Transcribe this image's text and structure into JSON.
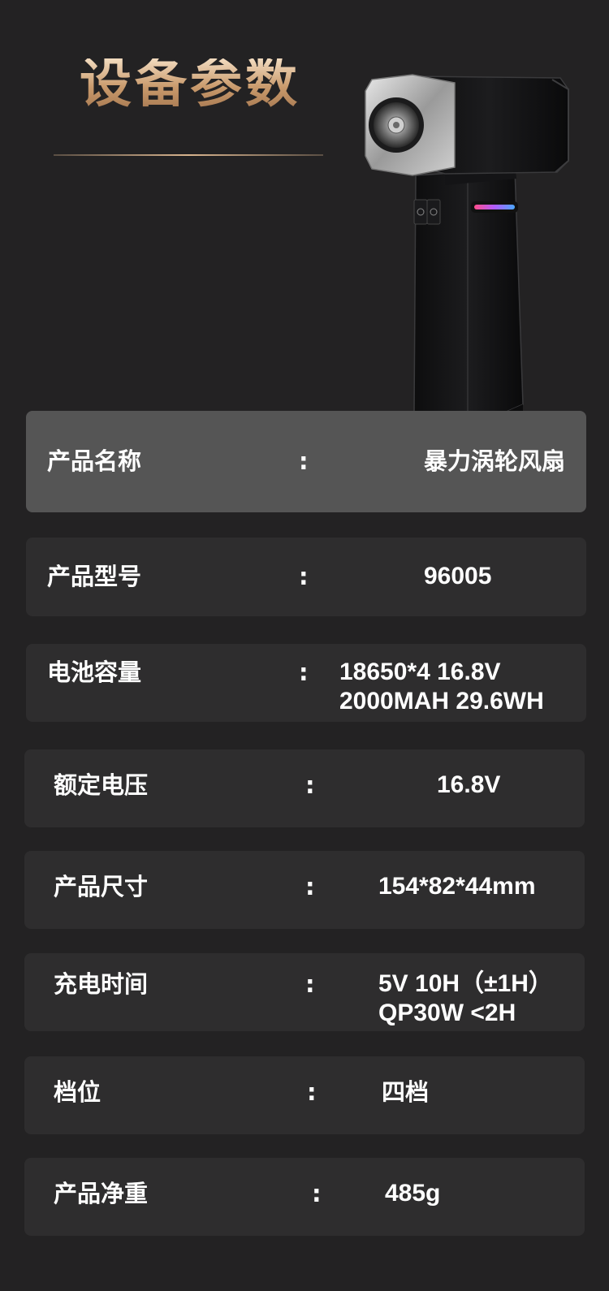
{
  "header": {
    "title": "设备参数"
  },
  "specs": [
    {
      "label": "产品名称",
      "colon": ":",
      "value": [
        "暴力涡轮风扇"
      ]
    },
    {
      "label": "产品型号",
      "colon": ":",
      "value": [
        "96005"
      ]
    },
    {
      "label": "电池容量",
      "colon": ":",
      "value": [
        "18650*4  16.8V",
        "2000MAH   29.6WH"
      ]
    },
    {
      "label": "额定电压",
      "colon": ":",
      "value": [
        "16.8V"
      ]
    },
    {
      "label": "产品尺寸",
      "colon": ":",
      "value": [
        "154*82*44mm"
      ]
    },
    {
      "label": "充电时间",
      "colon": ":",
      "value": [
        "5V 10H（±1H）",
        "QP30W <2H"
      ]
    },
    {
      "label": "档位",
      "colon": ":",
      "value": [
        "四档"
      ]
    },
    {
      "label": "产品净重",
      "colon": ":",
      "value": [
        "485g"
      ]
    }
  ],
  "colors": {
    "background": "#232223",
    "row": "#2e2d2e",
    "row_highlight": "#555555",
    "title_gold": "#d8b48e"
  },
  "icons": {
    "product": "turbo-fan-product-image"
  }
}
